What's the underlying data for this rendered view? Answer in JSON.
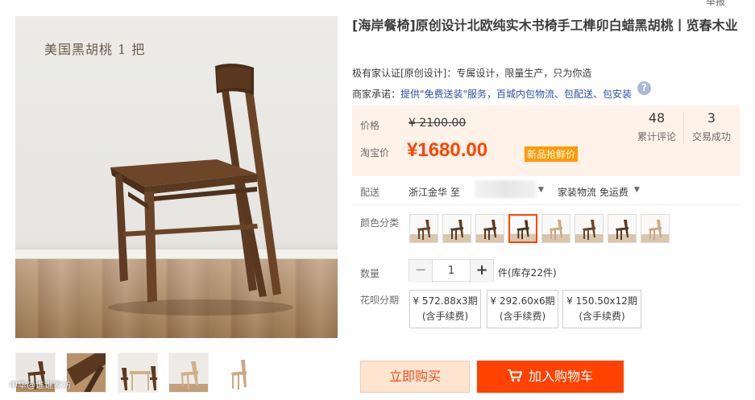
{
  "gallery": {
    "caption": "美国黑胡桃 1 把",
    "thumbnails": [
      "chair-front",
      "chair-closeup",
      "chair-dining-set",
      "chair-white-oak",
      "chair-white-oak-side"
    ],
    "watermark": "中华@谁谁家坊"
  },
  "top_link": "举报",
  "product": {
    "title": "[海岸餐椅]原创设计北欧纯实木书椅手工榫卯白蜡黑胡桃丨览春木业",
    "subtitle": "极有家认证[原创设计]：专属设计，限量生产，只为你造",
    "promise_label": "商家承诺：",
    "promise_text": "提供\"免费送装\"服务，百城内包物流、包配送、包安装"
  },
  "price": {
    "orig_label": "价格",
    "orig_price": "¥ 2100.00",
    "promo_label": "淘宝价",
    "promo_price": "¥1680.00",
    "promo_badge": "新品抢鲜价",
    "reviews_count": "48",
    "reviews_label": "累计评论",
    "sales_count": "3",
    "sales_label": "交易成功"
  },
  "shipping": {
    "label": "配送",
    "from": "浙江金华 至",
    "method": "家装物流 免运费"
  },
  "color": {
    "label": "颜色分类",
    "selected_index": 3,
    "swatches": [
      "walnut-1",
      "walnut-2",
      "walnut-3",
      "walnut-4",
      "oak-1",
      "walnut-5",
      "walnut-6",
      "oak-2"
    ]
  },
  "quantity": {
    "label": "数量",
    "value": "1",
    "minus": "−",
    "plus": "+",
    "stock": "件(库存22件)"
  },
  "installment": {
    "label": "花呗分期",
    "options": [
      {
        "price": "¥ 572.88x3期",
        "fee": "(含手续费)"
      },
      {
        "price": "¥ 292.60x6期",
        "fee": "(含手续费)"
      },
      {
        "price": "¥ 150.50x12期",
        "fee": "(含手续费)"
      }
    ]
  },
  "actions": {
    "buy_now": "立即购买",
    "add_cart": "加入购物车"
  },
  "colors": {
    "accent": "#ff4400",
    "price_bg": "#fff2e8",
    "badge": "#ff9a00",
    "link": "#2953a6"
  }
}
